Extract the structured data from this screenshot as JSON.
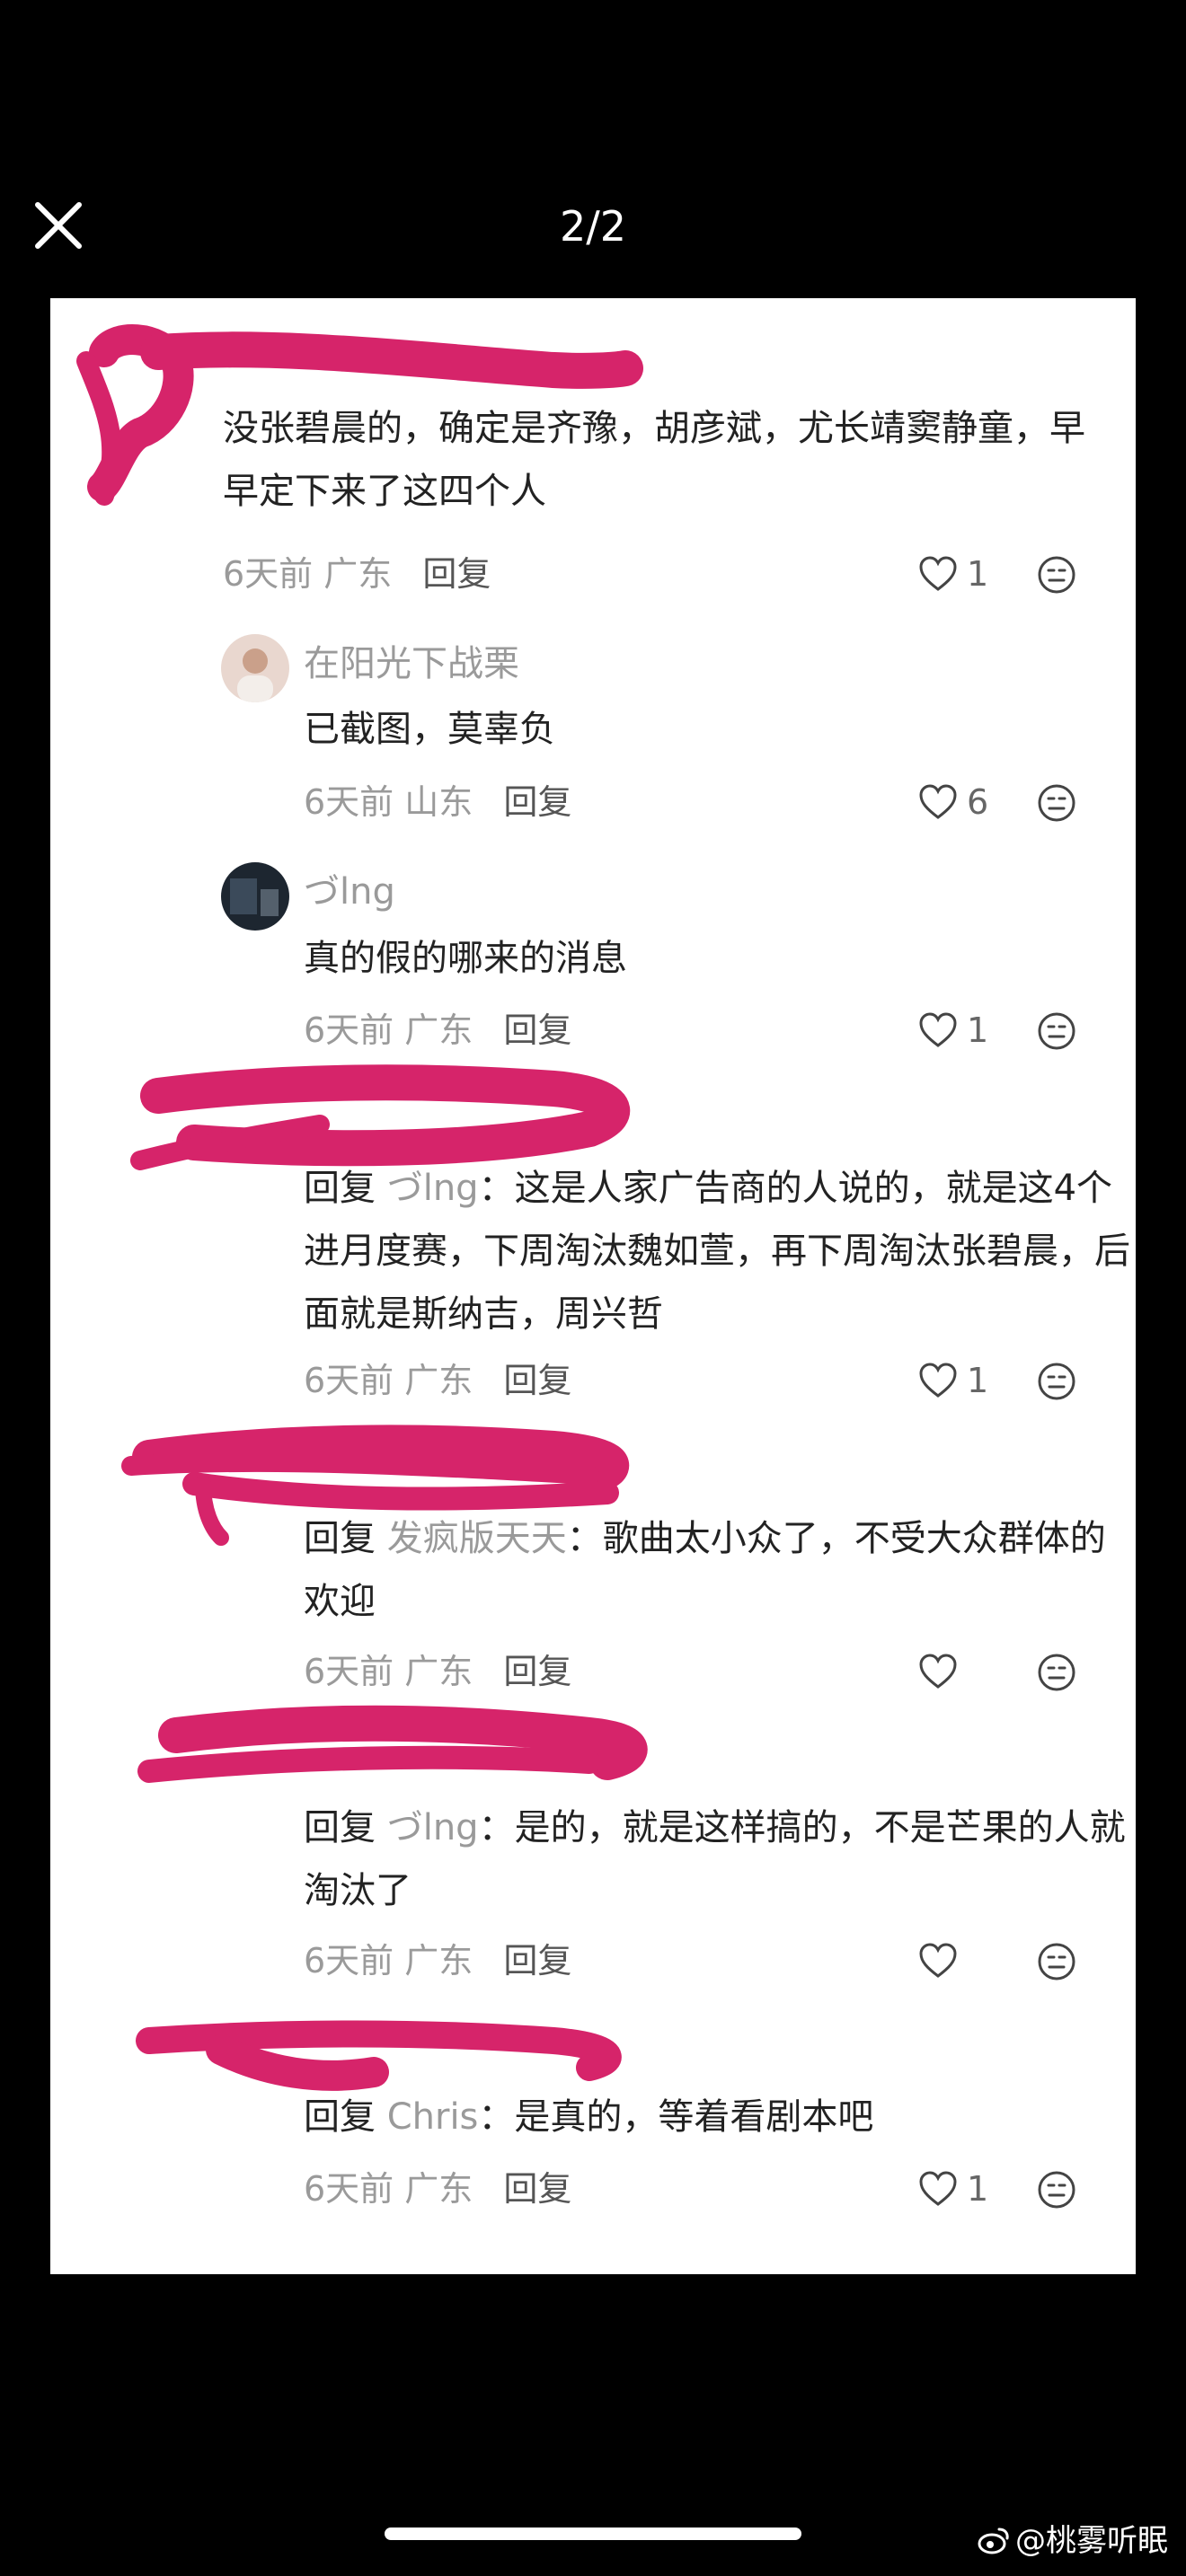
{
  "viewer": {
    "close_icon": "close-icon",
    "counter": "2/2"
  },
  "comments": [
    {
      "id": "c1",
      "text": "没张碧晨的，确定是齐豫，胡彦斌，尤长靖窦静童，早早定下来了这四个人",
      "time": "6天前",
      "region": "广东",
      "reply_label": "回复",
      "likes": "1"
    },
    {
      "id": "c2",
      "username": "在阳光下战栗",
      "text": "已截图，莫辜负",
      "time": "6天前",
      "region": "山东",
      "reply_label": "回复",
      "likes": "6"
    },
    {
      "id": "c3",
      "username": "づlng",
      "text": "真的假的哪来的消息",
      "time": "6天前",
      "region": "广东",
      "reply_label": "回复",
      "likes": "1"
    },
    {
      "id": "c4",
      "prefix": "回复",
      "target": "づlng",
      "text": "这是人家广告商的人说的，就是这4个进月度赛，下周淘汰魏如萱，再下周淘汰张碧晨，后面就是斯纳吉，周兴哲",
      "time": "6天前",
      "region": "广东",
      "reply_label": "回复",
      "likes": "1"
    },
    {
      "id": "c5",
      "prefix": "回复",
      "target": "发疯版天天",
      "text": "歌曲太小众了，不受大众群体的欢迎",
      "time": "6天前",
      "region": "广东",
      "reply_label": "回复",
      "likes": ""
    },
    {
      "id": "c6",
      "prefix": "回复",
      "target": "づlng",
      "text": "是的，就是这样搞的，不是芒果的人就淘汰了",
      "time": "6天前",
      "region": "广东",
      "reply_label": "回复",
      "likes": ""
    },
    {
      "id": "c7",
      "prefix": "回复",
      "target": "Chris",
      "text": "是真的，等着看剧本吧",
      "time": "6天前",
      "region": "广东",
      "reply_label": "回复",
      "likes": "1"
    }
  ],
  "icons": {
    "like": "heart-outline-icon",
    "emoji": "emoji-face-icon",
    "weibo": "weibo-logo-icon"
  },
  "colors": {
    "scribble": "#d6246a",
    "background": "#000000",
    "card": "#ffffff",
    "muted_text": "#9a9a9a"
  },
  "watermark": "@桃雾听眠"
}
